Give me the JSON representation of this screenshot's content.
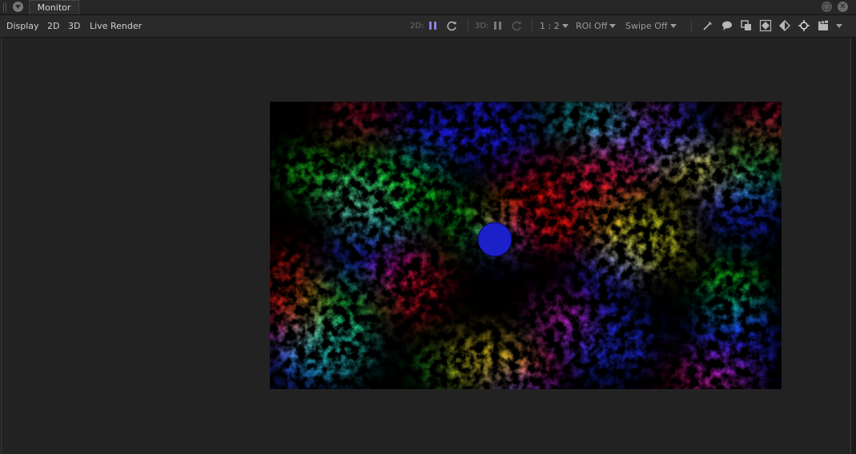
{
  "tabbar": {
    "tab_label": "Monitor",
    "maximize_icon": "maximize-icon",
    "close_icon": "close-icon"
  },
  "menu": {
    "display": "Display",
    "mode_2d": "2D",
    "mode_3d": "3D",
    "live_render": "Live Render"
  },
  "toolbar": {
    "label_2d": "2D:",
    "label_3d": "3D:",
    "zoom": "1 : 2",
    "roi": "ROI Off",
    "swipe": "Swipe Off",
    "accent": "#8a7fe8",
    "icons": [
      "pause-icon",
      "refresh-icon",
      "pause-icon",
      "refresh-icon",
      "eyedropper-icon",
      "comment-icon",
      "overlay-icon",
      "safe-frame-icon",
      "compare-icon",
      "crosshair-icon",
      "clapperboard-icon"
    ]
  },
  "viewport": {
    "background": "#222222",
    "content": "rendered noise image with blue circle"
  }
}
